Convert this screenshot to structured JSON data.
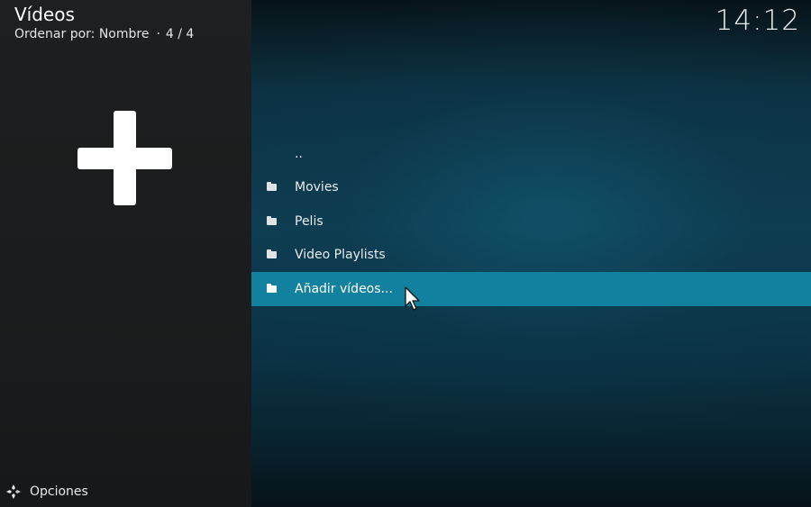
{
  "header": {
    "title": "Vídeos",
    "sort_label": "Ordenar por: Nombre",
    "separator": "·",
    "count": "4 / 4"
  },
  "clock": "14:12",
  "sidebar": {
    "add_icon": "plus-icon"
  },
  "list": {
    "items": [
      {
        "label": "..",
        "icon": ""
      },
      {
        "label": "Movies",
        "icon": "folder-icon"
      },
      {
        "label": "Pelis",
        "icon": "folder-icon"
      },
      {
        "label": "Video Playlists",
        "icon": "folder-icon"
      },
      {
        "label": "Añadir vídeos...",
        "icon": "folder-icon",
        "selected": true
      }
    ]
  },
  "footer": {
    "options_label": "Opciones",
    "options_icon": "options-icon"
  },
  "colors": {
    "selection": "#12809f",
    "left_pane": "#1d1f20",
    "right_pane": "#0e3d52",
    "text": "#ffffff"
  }
}
